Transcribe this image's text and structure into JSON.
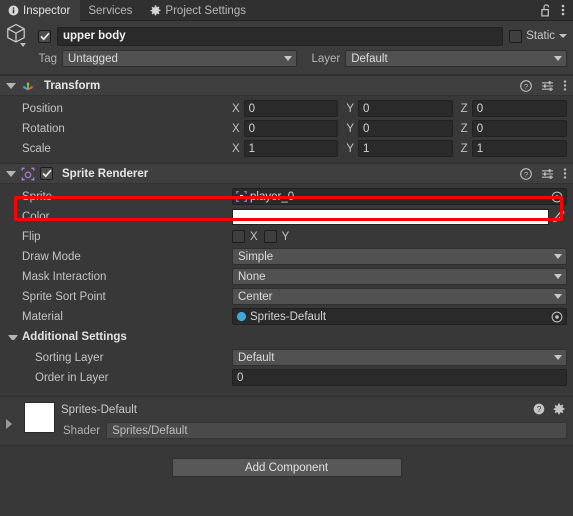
{
  "window": {
    "tabs": [
      {
        "label": "Inspector",
        "icon": "info-icon",
        "active": true
      },
      {
        "label": "Services",
        "icon": null,
        "active": false
      },
      {
        "label": "Project Settings",
        "icon": "gear-icon",
        "active": false
      }
    ],
    "lock_icon": "padlock-open-icon",
    "menu_icon": "kebab-menu-icon"
  },
  "gameobject": {
    "icon": "cube-icon",
    "enabled": true,
    "name": "upper body",
    "static_label": "Static",
    "static_checked": false,
    "tag_label": "Tag",
    "tag_value": "Untagged",
    "layer_label": "Layer",
    "layer_value": "Default"
  },
  "transform": {
    "title": "Transform",
    "icon": "transform-axis-icon",
    "expanded": true,
    "rows": [
      {
        "label": "Position",
        "x": "0",
        "y": "0",
        "z": "0"
      },
      {
        "label": "Rotation",
        "x": "0",
        "y": "0",
        "z": "0"
      },
      {
        "label": "Scale",
        "x": "1",
        "y": "1",
        "z": "1"
      }
    ],
    "axis_labels": {
      "x": "X",
      "y": "Y",
      "z": "Z"
    }
  },
  "sprite_renderer": {
    "title": "Sprite Renderer",
    "icon": "sprite-renderer-icon",
    "enabled": true,
    "expanded": true,
    "sprite": {
      "label": "Sprite",
      "value": "player_0",
      "icon": "sprite-asset-icon",
      "highlighted": true
    },
    "color": {
      "label": "Color",
      "value": "#FFFFFF",
      "eyedropper_icon": "eyedropper-icon"
    },
    "flip": {
      "label": "Flip",
      "x_label": "X",
      "y_label": "Y",
      "x_checked": false,
      "y_checked": false
    },
    "draw_mode": {
      "label": "Draw Mode",
      "value": "Simple"
    },
    "mask_interaction": {
      "label": "Mask Interaction",
      "value": "None"
    },
    "sprite_sort_point": {
      "label": "Sprite Sort Point",
      "value": "Center"
    },
    "material": {
      "label": "Material",
      "value": "Sprites-Default",
      "icon": "material-sphere-icon"
    },
    "additional_settings": {
      "title": "Additional Settings",
      "expanded": true,
      "sorting_layer": {
        "label": "Sorting Layer",
        "value": "Default"
      },
      "order_in_layer": {
        "label": "Order in Layer",
        "value": "0"
      }
    }
  },
  "material_preview": {
    "name": "Sprites-Default",
    "swatch_color": "#FFFFFF",
    "shader_label": "Shader",
    "shader_value": "Sprites/Default",
    "help_icon": "help-icon",
    "gear_icon": "gear-icon",
    "expanded": false
  },
  "add_component": {
    "label": "Add Component"
  },
  "colors": {
    "highlight": "#ff0000",
    "panel_bg": "#383838",
    "header_bg": "#3f3f3f",
    "field_bg": "#2a2a2a"
  }
}
